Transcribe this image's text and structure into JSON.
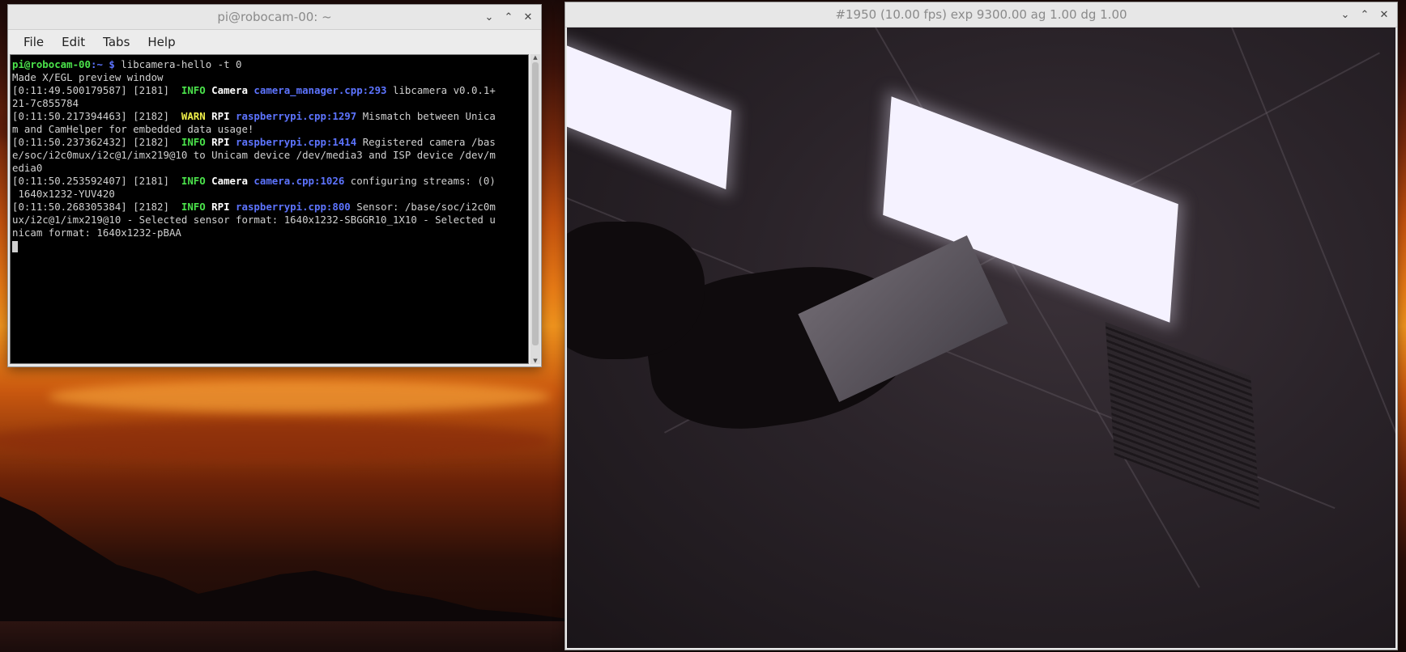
{
  "terminal": {
    "title": "pi@robocam-00: ~",
    "menu": [
      "File",
      "Edit",
      "Tabs",
      "Help"
    ],
    "prompt_user": "pi@robocam-00",
    "prompt_path": ":~ $ ",
    "command": "libcamera-hello -t 0",
    "lines": {
      "l1": "Made X/EGL preview window",
      "l2_pre": "[0:11:49.500179587] [2181]  ",
      "l2_lvl": "INFO",
      "l2_cat": " Camera ",
      "l2_src": "camera_manager.cpp:293",
      "l2_msg": " libcamera v0.0.1+",
      "l2b": "21-7c855784",
      "l3_pre": "[0:11:50.217394463] [2182]  ",
      "l3_lvl": "WARN",
      "l3_cat": " RPI ",
      "l3_src": "raspberrypi.cpp:1297",
      "l3_msg": " Mismatch between Unica",
      "l3b": "m and CamHelper for embedded data usage!",
      "l4_pre": "[0:11:50.237362432] [2182]  ",
      "l4_lvl": "INFO",
      "l4_cat": " RPI ",
      "l4_src": "raspberrypi.cpp:1414",
      "l4_msg": " Registered camera /bas",
      "l4b": "e/soc/i2c0mux/i2c@1/imx219@10 to Unicam device /dev/media3 and ISP device /dev/m",
      "l4c": "edia0",
      "l5_pre": "[0:11:50.253592407] [2181]  ",
      "l5_lvl": "INFO",
      "l5_cat": " Camera ",
      "l5_src": "camera.cpp:1026",
      "l5_msg": " configuring streams: (0)",
      "l5b": " 1640x1232-YUV420",
      "l6_pre": "[0:11:50.268305384] [2182]  ",
      "l6_lvl": "INFO",
      "l6_cat": " RPI ",
      "l6_src": "raspberrypi.cpp:800",
      "l6_msg": " Sensor: /base/soc/i2c0m",
      "l6b": "ux/i2c@1/imx219@10 - Selected sensor format: 1640x1232-SBGGR10_1X10 - Selected u",
      "l6c": "nicam format: 1640x1232-pBAA"
    }
  },
  "camera_window": {
    "title": "#1950 (10.00 fps) exp 9300.00 ag 1.00 dg 1.00"
  },
  "controls": {
    "minimize": "⌄",
    "maximize": "⌃",
    "close": "✕"
  },
  "colors": {
    "prompt_green": "#4be34b",
    "source_blue": "#5d74ff",
    "warn_yellow": "#f0f04a"
  }
}
